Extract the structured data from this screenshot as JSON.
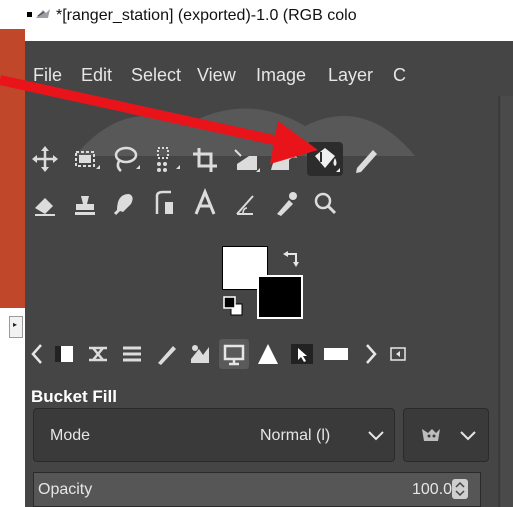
{
  "window": {
    "title": "*[ranger_station] (exported)-1.0 (RGB colo"
  },
  "menubar": {
    "items": [
      "File",
      "Edit",
      "Select",
      "View",
      "Image",
      "Layer",
      "C"
    ]
  },
  "toolbox": {
    "active_tool": "bucket-fill",
    "foreground_color": "#ffffff",
    "background_color": "#000000"
  },
  "tool_options": {
    "title": "Bucket Fill",
    "mode_label": "Mode",
    "mode_value": "Normal (l)",
    "opacity_label": "Opacity",
    "opacity_value": "100.0"
  },
  "annotation": {
    "arrow_color": "#e8141a"
  }
}
